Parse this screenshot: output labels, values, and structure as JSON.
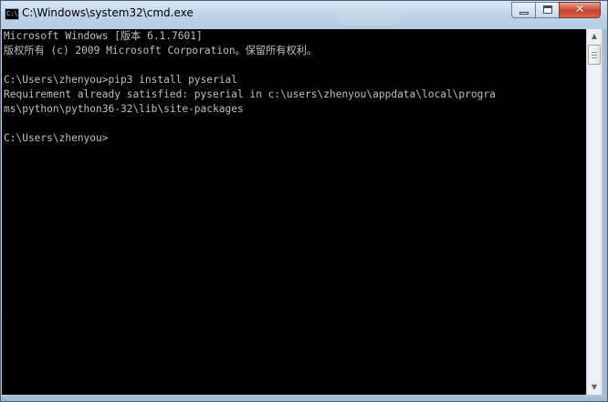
{
  "window": {
    "title": "C:\\Windows\\system32\\cmd.exe",
    "icon": "cmd-icon",
    "icon_text": "C:\\",
    "controls": {
      "minimize_icon": "minimize-icon",
      "maximize_icon": "maximize-icon",
      "close_icon": "close-icon",
      "close_glyph": "✕"
    }
  },
  "console": {
    "lines": [
      "Microsoft Windows [版本 6.1.7601]",
      "版权所有 (c) 2009 Microsoft Corporation。保留所有权利。",
      "",
      "C:\\Users\\zhenyou>pip3 install pyserial",
      "Requirement already satisfied: pyserial in c:\\users\\zhenyou\\appdata\\local\\progra",
      "ms\\python\\python36-32\\lib\\site-packages",
      "",
      "C:\\Users\\zhenyou>"
    ],
    "colors": {
      "background": "#000000",
      "text": "#c0c0c0"
    }
  },
  "scrollbar": {
    "up_icon": "scroll-up-arrow-icon",
    "down_icon": "scroll-down-arrow-icon",
    "up_glyph": "▲",
    "down_glyph": "▼"
  }
}
